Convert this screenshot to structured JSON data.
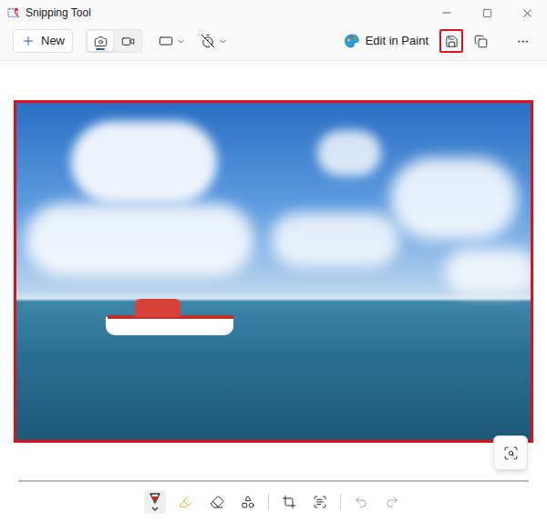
{
  "window": {
    "title": "Snipping Tool"
  },
  "toolbar": {
    "new_button": "New",
    "modes": [
      {
        "kind": "screenshot",
        "selected": true
      },
      {
        "kind": "video",
        "selected": false
      }
    ],
    "edit_button": "Edit in Paint",
    "actions": [
      {
        "kind": "save",
        "highlighted": true
      },
      {
        "kind": "copy",
        "highlighted": false
      },
      {
        "kind": "more",
        "highlighted": false
      }
    ]
  },
  "capture": {
    "outlined": true
  },
  "markup_tools": [
    {
      "kind": "pen",
      "selected": true,
      "disabled": false
    },
    {
      "kind": "highlighter",
      "selected": false,
      "disabled": false
    },
    {
      "kind": "eraser",
      "selected": false,
      "disabled": false
    },
    {
      "kind": "shapes",
      "selected": false,
      "disabled": false
    },
    {
      "kind": "crop",
      "selected": false,
      "disabled": false
    },
    {
      "kind": "text-actions",
      "selected": false,
      "disabled": false
    },
    {
      "kind": "undo",
      "selected": false,
      "disabled": true
    },
    {
      "kind": "redo",
      "selected": false,
      "disabled": true
    }
  ]
}
